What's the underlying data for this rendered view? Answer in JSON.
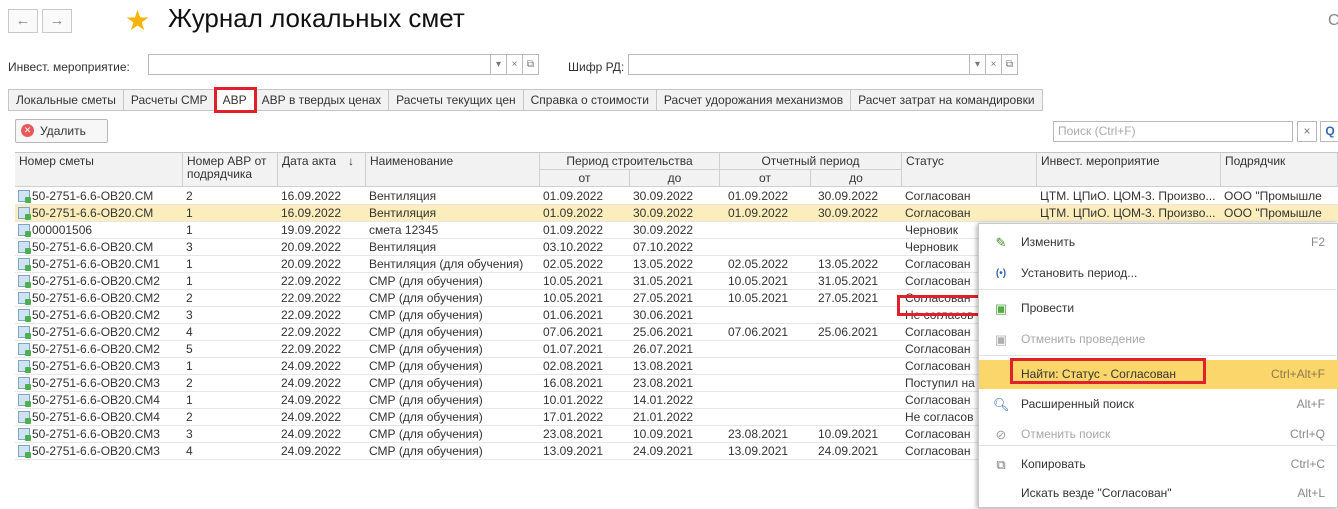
{
  "nav": {
    "back": "←",
    "forward": "→"
  },
  "title": "Журнал локальных смет",
  "right_edge_glyph": "С",
  "filters": {
    "invest_label": "Инвест. мероприятие:",
    "invest_value": "",
    "rd_label": "Шифр РД:",
    "rd_value": ""
  },
  "tabs": [
    "Локальные сметы",
    "Расчеты СМР",
    "АВР",
    "АВР в твердых ценах",
    "Расчеты текущих цен",
    "Справка о стоимости",
    "Расчет удорожания механизмов",
    "Расчет затрат на командировки"
  ],
  "active_tab": "АВР",
  "toolbar": {
    "delete_label": "Удалить",
    "search_placeholder": "Поиск (Ctrl+F)"
  },
  "columns": {
    "number": "Номер сметы",
    "avr_number": "Номер АВР от подрядчика",
    "date": "Дата акта",
    "sort_arrow": "↓",
    "name": "Наименование",
    "build_period": "Период строительства",
    "report_period": "Отчетный период",
    "from": "от",
    "to": "до",
    "status": "Статус",
    "invest": "Инвест. мероприятие",
    "contractor": "Подрядчик"
  },
  "rows": [
    {
      "num": "50-2751-6.6-ОВ20.СМ",
      "avr": "2",
      "date": "16.09.2022",
      "name": "Вентиляция",
      "b_from": "01.09.2022",
      "b_to": "30.09.2022",
      "r_from": "01.09.2022",
      "r_to": "30.09.2022",
      "status": "Согласован",
      "invest": "ЦТМ. ЦПиО. ЦОМ-3. Произво...",
      "contractor": "ООО \"Промышле"
    },
    {
      "num": "50-2751-6.6-ОВ20.СМ",
      "avr": "1",
      "date": "16.09.2022",
      "name": "Вентиляция",
      "b_from": "01.09.2022",
      "b_to": "30.09.2022",
      "r_from": "01.09.2022",
      "r_to": "30.09.2022",
      "status": "Согласован",
      "invest": "ЦТМ. ЦПиО. ЦОМ-3. Произво...",
      "contractor": "ООО \"Промышле"
    },
    {
      "num": "000001506",
      "avr": "1",
      "date": "19.09.2022",
      "name": "смета 12345",
      "b_from": "01.09.2022",
      "b_to": "30.09.2022",
      "r_from": "",
      "r_to": "",
      "status": "Черновик",
      "invest": "",
      "contractor": ""
    },
    {
      "num": "50-2751-6.6-ОВ20.СМ",
      "avr": "3",
      "date": "20.09.2022",
      "name": "Вентиляция",
      "b_from": "03.10.2022",
      "b_to": "07.10.2022",
      "r_from": "",
      "r_to": "",
      "status": "Черновик",
      "invest": "",
      "contractor": ""
    },
    {
      "num": "50-2751-6.6-ОВ20.СМ1",
      "avr": "1",
      "date": "20.09.2022",
      "name": "Вентиляция (для обучения)",
      "b_from": "02.05.2022",
      "b_to": "13.05.2022",
      "r_from": "02.05.2022",
      "r_to": "13.05.2022",
      "status": "Согласован",
      "invest": "",
      "contractor": ""
    },
    {
      "num": "50-2751-6.6-ОВ20.СМ2",
      "avr": "1",
      "date": "22.09.2022",
      "name": "СМР (для обучения)",
      "b_from": "10.05.2021",
      "b_to": "31.05.2021",
      "r_from": "10.05.2021",
      "r_to": "31.05.2021",
      "status": "Согласован",
      "invest": "",
      "contractor": ""
    },
    {
      "num": "50-2751-6.6-ОВ20.СМ2",
      "avr": "2",
      "date": "22.09.2022",
      "name": "СМР (для обучения)",
      "b_from": "10.05.2021",
      "b_to": "27.05.2021",
      "r_from": "10.05.2021",
      "r_to": "27.05.2021",
      "status": "Согласован",
      "invest": "",
      "contractor": ""
    },
    {
      "num": "50-2751-6.6-ОВ20.СМ2",
      "avr": "3",
      "date": "22.09.2022",
      "name": "СМР (для обучения)",
      "b_from": "01.06.2021",
      "b_to": "30.06.2021",
      "r_from": "",
      "r_to": "",
      "status": "Не согласов",
      "invest": "",
      "contractor": ""
    },
    {
      "num": "50-2751-6.6-ОВ20.СМ2",
      "avr": "4",
      "date": "22.09.2022",
      "name": "СМР (для обучения)",
      "b_from": "07.06.2021",
      "b_to": "25.06.2021",
      "r_from": "07.06.2021",
      "r_to": "25.06.2021",
      "status": "Согласован",
      "invest": "",
      "contractor": ""
    },
    {
      "num": "50-2751-6.6-ОВ20.СМ2",
      "avr": "5",
      "date": "22.09.2022",
      "name": "СМР (для обучения)",
      "b_from": "01.07.2021",
      "b_to": "26.07.2021",
      "r_from": "",
      "r_to": "",
      "status": "Согласован",
      "invest": "",
      "contractor": ""
    },
    {
      "num": "50-2751-6.6-ОВ20.СМ3",
      "avr": "1",
      "date": "24.09.2022",
      "name": "СМР (для обучения)",
      "b_from": "02.08.2021",
      "b_to": "13.08.2021",
      "r_from": "",
      "r_to": "",
      "status": "Согласован",
      "invest": "",
      "contractor": ""
    },
    {
      "num": "50-2751-6.6-ОВ20.СМ3",
      "avr": "2",
      "date": "24.09.2022",
      "name": "СМР (для обучения)",
      "b_from": "16.08.2021",
      "b_to": "23.08.2021",
      "r_from": "",
      "r_to": "",
      "status": "Поступил на",
      "invest": "",
      "contractor": ""
    },
    {
      "num": "50-2751-6.6-ОВ20.СМ4",
      "avr": "1",
      "date": "24.09.2022",
      "name": "СМР (для обучения)",
      "b_from": "10.01.2022",
      "b_to": "14.01.2022",
      "r_from": "",
      "r_to": "",
      "status": "Согласован",
      "invest": "",
      "contractor": ""
    },
    {
      "num": "50-2751-6.6-ОВ20.СМ4",
      "avr": "2",
      "date": "24.09.2022",
      "name": "СМР (для обучения)",
      "b_from": "17.01.2022",
      "b_to": "21.01.2022",
      "r_from": "",
      "r_to": "",
      "status": "Не согласов",
      "invest": "",
      "contractor": ""
    },
    {
      "num": "50-2751-6.6-ОВ20.СМ3",
      "avr": "3",
      "date": "24.09.2022",
      "name": "СМР (для обучения)",
      "b_from": "23.08.2021",
      "b_to": "10.09.2021",
      "r_from": "23.08.2021",
      "r_to": "10.09.2021",
      "status": "Согласован",
      "invest": "",
      "contractor": ""
    },
    {
      "num": "50-2751-6.6-ОВ20.СМ3",
      "avr": "4",
      "date": "24.09.2022",
      "name": "СМР (для обучения)",
      "b_from": "13.09.2021",
      "b_to": "24.09.2021",
      "r_from": "13.09.2021",
      "r_to": "24.09.2021",
      "status": "Согласован",
      "invest": "",
      "contractor": ""
    }
  ],
  "context_menu": [
    {
      "label": "Изменить",
      "shortcut": "F2",
      "icon": "pencil-icon",
      "disabled": false
    },
    {
      "label": "Установить период...",
      "shortcut": "",
      "icon": "period-icon",
      "disabled": false
    },
    {
      "label": "Провести",
      "shortcut": "",
      "icon": "post-icon",
      "disabled": false
    },
    {
      "label": "Отменить проведение",
      "shortcut": "",
      "icon": "unpost-icon",
      "disabled": true
    },
    {
      "label": "Найти: Статус - Согласован",
      "shortcut": "Ctrl+Alt+F",
      "icon": "",
      "disabled": false
    },
    {
      "label": "Расширенный поиск",
      "shortcut": "Alt+F",
      "icon": "search-icon",
      "disabled": false
    },
    {
      "label": "Отменить поиск",
      "shortcut": "Ctrl+Q",
      "icon": "cancel-search-icon",
      "disabled": true
    },
    {
      "label": "Копировать",
      "shortcut": "Ctrl+C",
      "icon": "copy-icon",
      "disabled": false
    },
    {
      "label": "Искать везде \"Согласован\"",
      "shortcut": "Alt+L",
      "icon": "",
      "disabled": false
    }
  ],
  "colors": {
    "accent_red": "#e0202a",
    "selected_row": "#fbeebc",
    "menu_highlight": "#fbd66a",
    "star": "#f4b400"
  }
}
